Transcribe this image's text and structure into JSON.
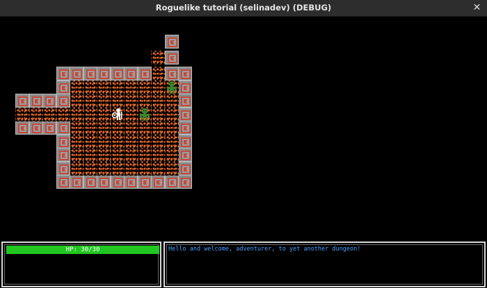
{
  "window": {
    "title": "Roguelike tutorial (selinadev) (DEBUG)",
    "close_glyph": "✕"
  },
  "colors": {
    "wall_base": "#8a8a8a",
    "wall_spiral": "#c44a3c",
    "floor_dots": "#e36a2b",
    "enemy": "#2e8b2e",
    "player": "#ffffff",
    "hp_bar": "#21c621",
    "log_text": "#4aa0ff"
  },
  "player": {
    "hp": "HP: 30/30",
    "hp_fraction": 1.0,
    "icon": "adventurer-with-shield-icon"
  },
  "enemies": [
    {
      "icon": "orc-icon"
    },
    {
      "icon": "orc-icon"
    }
  ],
  "message_log": [
    "Hello and welcome, adventurer, to yet another dungeon!"
  ]
}
